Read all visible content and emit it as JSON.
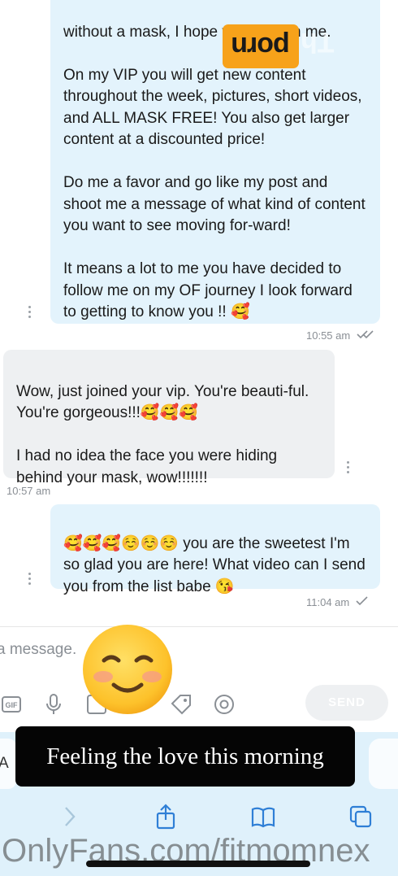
{
  "messages": [
    {
      "direction": "sent",
      "text": "without a mask, I hope you will join me.\n\nOn my VIP you will get new content throughout the week, pictures, short videos, and ALL MASK FREE! You also get larger content at a discounted price!\n\nDo me a favor and go like my post and shoot me a message of what kind of content you want to see moving for-ward!\n\nIt means a lot to me you have decided to follow me on my OF journey I look forward to getting to know you !! 🥰",
      "time": "10:55 am",
      "status": "double-check"
    },
    {
      "direction": "received",
      "text": "Wow, just joined your vip. You're beauti-ful. You're gorgeous!!!🥰🥰🥰\n\nI had no idea the face you were hiding behind your mask, wow!!!!!!!",
      "time": "10:57 am"
    },
    {
      "direction": "sent",
      "text": "🥰🥰🥰☺️☺️☺️ you are the sweetest I'm so glad you are here! What video can I send you from the list babe 😘",
      "time": "11:04 am",
      "status": "check"
    }
  ],
  "composer": {
    "placeholder": "a message.",
    "send_label": "SEND",
    "tools": [
      "gif-icon",
      "microphone-icon",
      "media-vault-icon",
      "price-tag-icon",
      "mention-icon"
    ]
  },
  "browser": {
    "url_fragment": "A",
    "nav_icons": [
      "forward-chevron-icon",
      "share-icon",
      "bookmarks-icon",
      "tabs-icon"
    ]
  },
  "overlay": {
    "caption": "Feeling the love this morning",
    "emoji": "smiling-face-icon",
    "logo_text": "porn",
    "logo_trailing": "Th",
    "watermark": "OnlyFans.com/fitmomnex"
  },
  "colors": {
    "sent_bubble": "#e3f3fc",
    "received_bubble": "#eef0f2",
    "logo": "#f7a21a",
    "browser_bar": "#dff1fb"
  }
}
